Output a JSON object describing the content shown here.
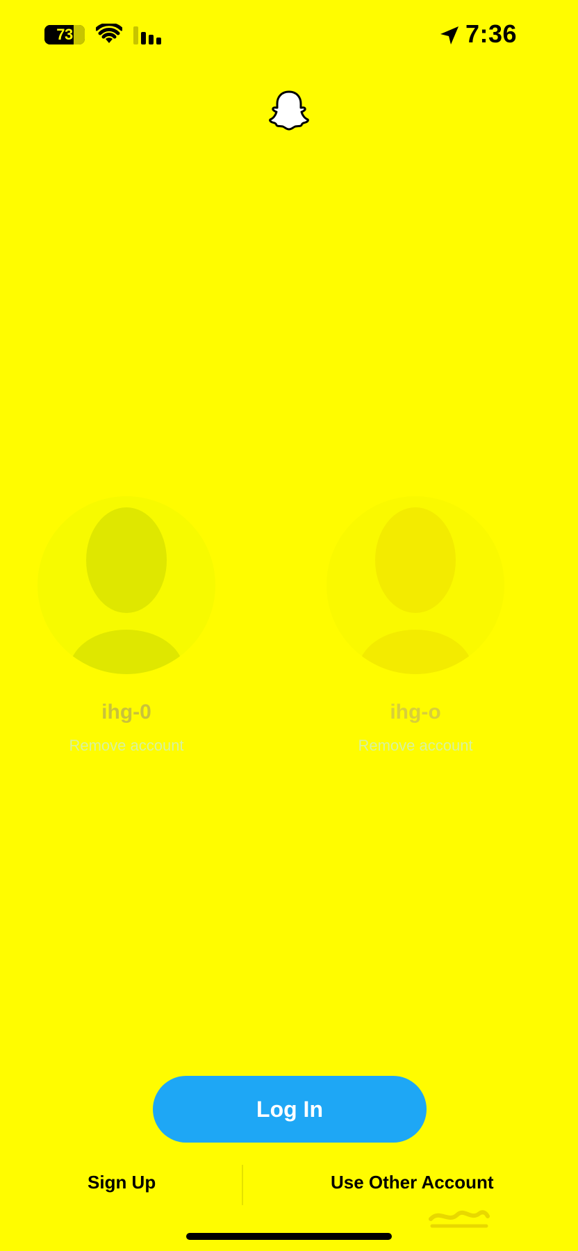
{
  "status_bar": {
    "battery_level": "73",
    "time": "7:36"
  },
  "accounts": [
    {
      "username": "ihg-0",
      "remove_label": "Remove account"
    },
    {
      "username": "ihg-o",
      "remove_label": "Remove account"
    }
  ],
  "actions": {
    "login_label": "Log In",
    "signup_label": "Sign Up",
    "other_account_label": "Use Other Account"
  },
  "colors": {
    "background": "#FFFC00",
    "login_button": "#1EA7F5",
    "text_primary": "#000000"
  },
  "icons": [
    "battery-icon",
    "wifi-icon",
    "signal-icon",
    "location-arrow-icon",
    "snapchat-ghost-icon",
    "avatar-silhouette-icon"
  ]
}
